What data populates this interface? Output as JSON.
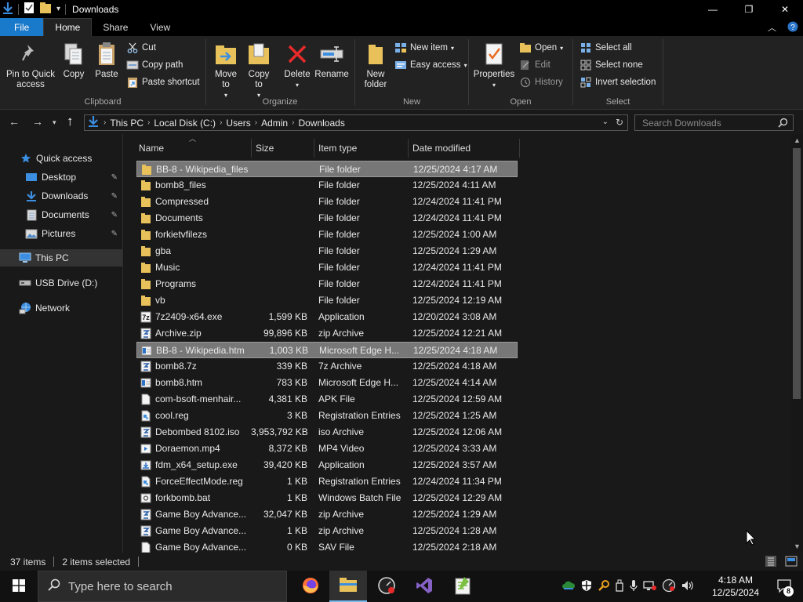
{
  "window": {
    "title": "Downloads",
    "controls": {
      "minimize": "—",
      "maximize": "❐",
      "close": "✕"
    }
  },
  "ribbon_tabs": [
    "File",
    "Home",
    "Share",
    "View"
  ],
  "ribbon": {
    "clipboard": {
      "label": "Clipboard",
      "pin": "Pin to Quick access",
      "copy": "Copy",
      "paste": "Paste",
      "cut": "Cut",
      "copy_path": "Copy path",
      "paste_shortcut": "Paste shortcut"
    },
    "organize": {
      "label": "Organize",
      "move_to": "Move to",
      "copy_to": "Copy to",
      "delete": "Delete",
      "rename": "Rename"
    },
    "new": {
      "label": "New",
      "new_folder": "New folder",
      "new_item": "New item",
      "easy_access": "Easy access"
    },
    "open": {
      "label": "Open",
      "properties": "Properties",
      "open": "Open",
      "edit": "Edit",
      "history": "History"
    },
    "select": {
      "label": "Select",
      "select_all": "Select all",
      "select_none": "Select none",
      "invert": "Invert selection"
    }
  },
  "address": {
    "crumbs": [
      "This PC",
      "Local Disk (C:)",
      "Users",
      "Admin",
      "Downloads"
    ],
    "search_placeholder": "Search Downloads"
  },
  "nav_pane": {
    "quick_access": "Quick access",
    "desktop": "Desktop",
    "downloads": "Downloads",
    "documents": "Documents",
    "pictures": "Pictures",
    "this_pc": "This PC",
    "usb": "USB Drive (D:)",
    "network": "Network"
  },
  "columns": {
    "name": "Name",
    "size": "Size",
    "type": "Item type",
    "date": "Date modified"
  },
  "files": [
    {
      "name": "BB-8 - Wikipedia_files",
      "size": "",
      "type": "File folder",
      "date": "12/25/2024 4:17 AM",
      "icon": "folder",
      "selected": true
    },
    {
      "name": "bomb8_files",
      "size": "",
      "type": "File folder",
      "date": "12/25/2024 4:11 AM",
      "icon": "folder",
      "selected": false
    },
    {
      "name": "Compressed",
      "size": "",
      "type": "File folder",
      "date": "12/24/2024 11:41 PM",
      "icon": "folder",
      "selected": false
    },
    {
      "name": "Documents",
      "size": "",
      "type": "File folder",
      "date": "12/24/2024 11:41 PM",
      "icon": "folder",
      "selected": false
    },
    {
      "name": "forkietvfilezs",
      "size": "",
      "type": "File folder",
      "date": "12/25/2024 1:00 AM",
      "icon": "folder",
      "selected": false
    },
    {
      "name": "gba",
      "size": "",
      "type": "File folder",
      "date": "12/25/2024 1:29 AM",
      "icon": "folder",
      "selected": false
    },
    {
      "name": "Music",
      "size": "",
      "type": "File folder",
      "date": "12/24/2024 11:41 PM",
      "icon": "folder",
      "selected": false
    },
    {
      "name": "Programs",
      "size": "",
      "type": "File folder",
      "date": "12/24/2024 11:41 PM",
      "icon": "folder",
      "selected": false
    },
    {
      "name": "vb",
      "size": "",
      "type": "File folder",
      "date": "12/25/2024 12:19 AM",
      "icon": "folder",
      "selected": false
    },
    {
      "name": "7z2409-x64.exe",
      "size": "1,599 KB",
      "type": "Application",
      "date": "12/20/2024 3:08 AM",
      "icon": "app",
      "selected": false
    },
    {
      "name": "Archive.zip",
      "size": "99,896 KB",
      "type": "zip Archive",
      "date": "12/25/2024 12:21 AM",
      "icon": "archive",
      "selected": false
    },
    {
      "name": "BB-8 - Wikipedia.htm",
      "size": "1,003 KB",
      "type": "Microsoft Edge H...",
      "date": "12/25/2024 4:18 AM",
      "icon": "htm",
      "selected": true
    },
    {
      "name": "bomb8.7z",
      "size": "339 KB",
      "type": "7z Archive",
      "date": "12/25/2024 4:18 AM",
      "icon": "archive",
      "selected": false
    },
    {
      "name": "bomb8.htm",
      "size": "783 KB",
      "type": "Microsoft Edge H...",
      "date": "12/25/2024 4:14 AM",
      "icon": "htm",
      "selected": false
    },
    {
      "name": "com-bsoft-menhair...",
      "size": "4,381 KB",
      "type": "APK File",
      "date": "12/25/2024 12:59 AM",
      "icon": "file",
      "selected": false
    },
    {
      "name": "cool.reg",
      "size": "3 KB",
      "type": "Registration Entries",
      "date": "12/25/2024 1:25 AM",
      "icon": "reg",
      "selected": false
    },
    {
      "name": "Debombed 8102.iso",
      "size": "3,953,792 KB",
      "type": "iso Archive",
      "date": "12/25/2024 12:06 AM",
      "icon": "archive",
      "selected": false
    },
    {
      "name": "Doraemon.mp4",
      "size": "8,372 KB",
      "type": "MP4 Video",
      "date": "12/25/2024 3:33 AM",
      "icon": "video",
      "selected": false
    },
    {
      "name": "fdm_x64_setup.exe",
      "size": "39,420 KB",
      "type": "Application",
      "date": "12/25/2024 3:57 AM",
      "icon": "setup",
      "selected": false
    },
    {
      "name": "ForceEffectMode.reg",
      "size": "1 KB",
      "type": "Registration Entries",
      "date": "12/24/2024 11:34 PM",
      "icon": "reg",
      "selected": false
    },
    {
      "name": "forkbomb.bat",
      "size": "1 KB",
      "type": "Windows Batch File",
      "date": "12/25/2024 12:29 AM",
      "icon": "bat",
      "selected": false
    },
    {
      "name": "Game Boy Advance...",
      "size": "32,047 KB",
      "type": "zip Archive",
      "date": "12/25/2024 1:29 AM",
      "icon": "archive",
      "selected": false
    },
    {
      "name": "Game Boy Advance...",
      "size": "1 KB",
      "type": "zip Archive",
      "date": "12/25/2024 1:28 AM",
      "icon": "archive",
      "selected": false
    },
    {
      "name": "Game Boy Advance...",
      "size": "0 KB",
      "type": "SAV File",
      "date": "12/25/2024 2:18 AM",
      "icon": "file",
      "selected": false
    }
  ],
  "status": {
    "count": "37 items",
    "selected": "2 items selected"
  },
  "taskbar": {
    "search_placeholder": "Type here to search",
    "time": "4:18 AM",
    "date": "12/25/2024",
    "notifications": "8"
  },
  "colors": {
    "accent": "#1979ca",
    "folder": "#e8c15a",
    "selection": "#777777"
  }
}
